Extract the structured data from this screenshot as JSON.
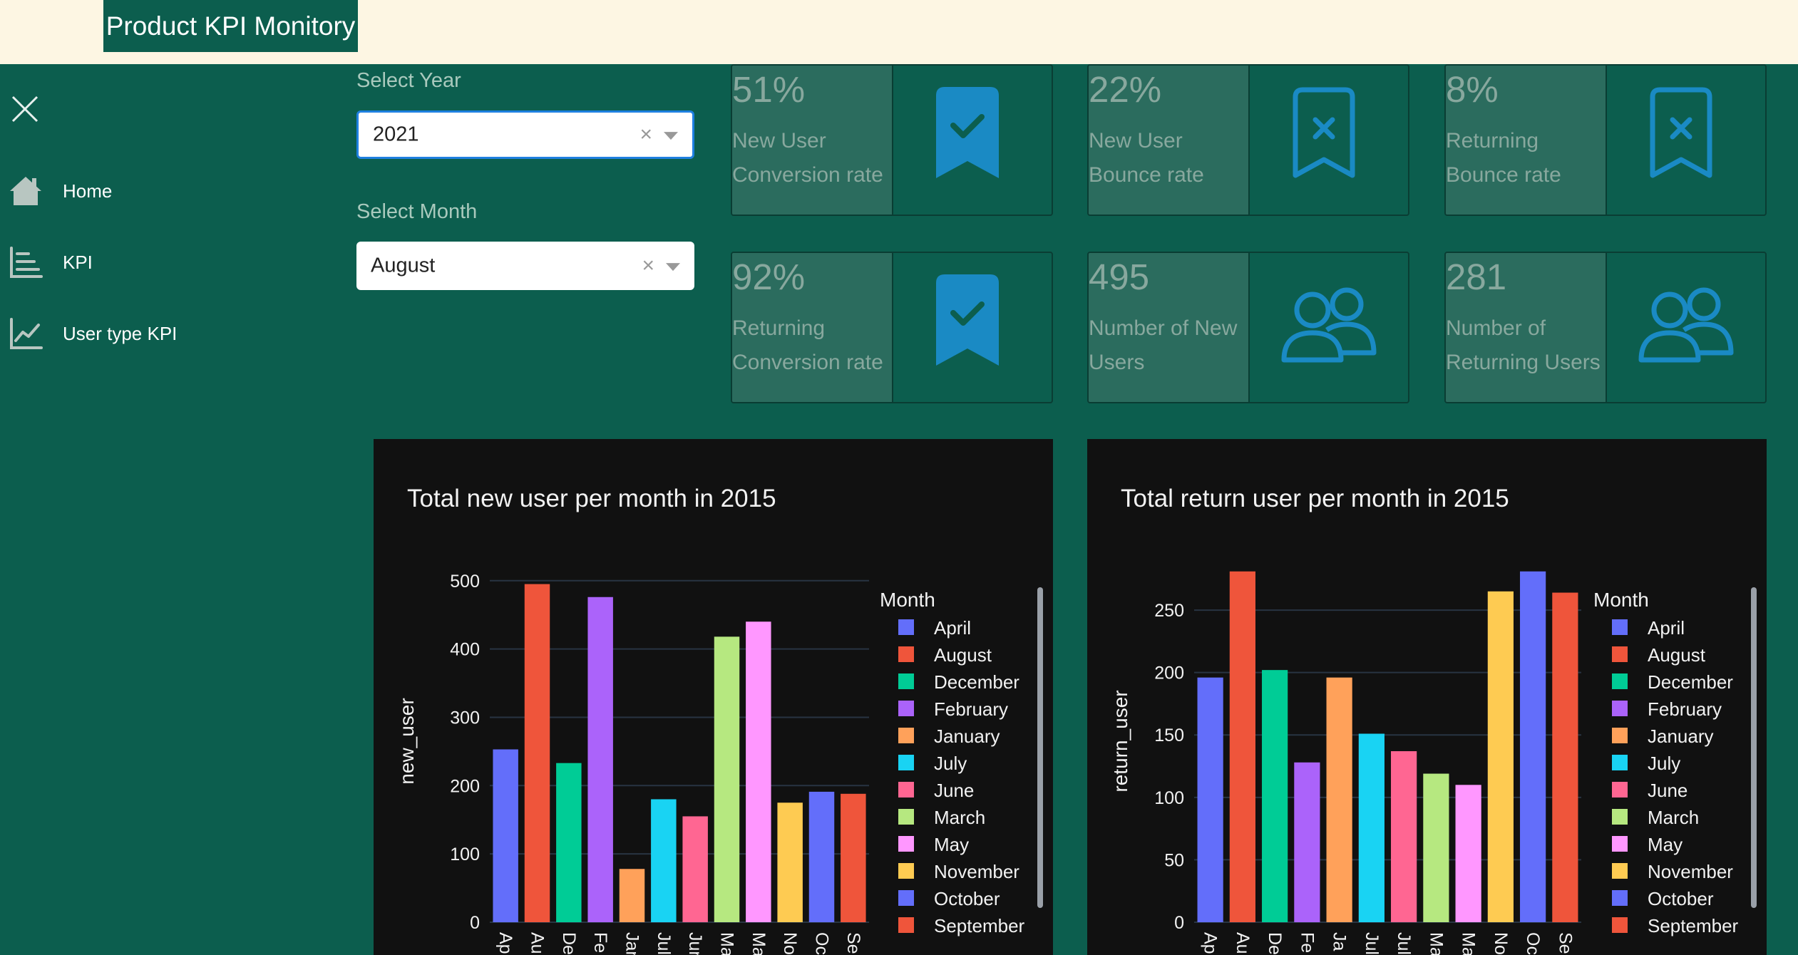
{
  "app": {
    "title": "Product KPI Monitory"
  },
  "sidebar": {
    "items": [
      {
        "label": "Home",
        "icon": "home-icon"
      },
      {
        "label": "KPI",
        "icon": "bar-chart-icon"
      },
      {
        "label": "User type KPI",
        "icon": "line-chart-icon"
      }
    ]
  },
  "filters": {
    "year": {
      "label": "Select Year",
      "value": "2021",
      "clear": "×"
    },
    "month": {
      "label": "Select Month",
      "value": "August",
      "clear": "×"
    }
  },
  "kpis": [
    {
      "value": "51%",
      "label": "New User Conversion rate",
      "icon": "bookmark-check-icon",
      "color": "#1a8ac4"
    },
    {
      "value": "22%",
      "label": "New User Bounce rate",
      "icon": "bookmark-x-icon",
      "color": "#1a8ac4"
    },
    {
      "value": "8%",
      "label": "Returning Bounce rate",
      "icon": "bookmark-x-icon",
      "color": "#1a8ac4"
    },
    {
      "value": "92%",
      "label": "Returning Conversion rate",
      "icon": "bookmark-check-icon",
      "color": "#1a8ac4"
    },
    {
      "value": "495",
      "label": "Number of New Users",
      "icon": "users-icon",
      "color": "#1a8ac4"
    },
    {
      "value": "281",
      "label": "Number of Returning Users",
      "icon": "users-icon",
      "color": "#1a8ac4"
    }
  ],
  "colors": {
    "background": "#0c5e4e",
    "topbar": "#fdf6e3",
    "accent_icon": "#1a8ac4",
    "chart_bg": "#111111"
  },
  "chart_data": [
    {
      "type": "bar",
      "title": "Total new user per month in 2015",
      "ylabel": "new_user",
      "xlabel": "",
      "ylim": [
        0,
        530
      ],
      "yticks": [
        0,
        100,
        200,
        300,
        400,
        500
      ],
      "categories": [
        "April",
        "August",
        "December",
        "February",
        "January",
        "July",
        "June",
        "March",
        "May",
        "November",
        "October",
        "September"
      ],
      "tick_labels": [
        "Ap",
        "Au",
        "De",
        "Fe",
        "Jan",
        "Jul",
        "Jun",
        "Ma",
        "Ma",
        "No",
        "Oc",
        "Se"
      ],
      "values": [
        253,
        495,
        233,
        476,
        78,
        180,
        155,
        418,
        440,
        175,
        191,
        188
      ],
      "legend_title": "Month",
      "legend": [
        "April",
        "August",
        "December",
        "February",
        "January",
        "July",
        "June",
        "March",
        "May",
        "November",
        "October",
        "September"
      ],
      "legend_colors": [
        "#636efa",
        "#ef553b",
        "#00cc96",
        "#ab63fa",
        "#ffa15a",
        "#19d3f3",
        "#ff6692",
        "#b6e880",
        "#ff97ff",
        "#fecb52",
        "#636efa",
        "#ef553b"
      ],
      "grid": true,
      "legend_position": "right"
    },
    {
      "type": "bar",
      "title": "Total return user per month in 2015",
      "ylabel": "return_user",
      "xlabel": "",
      "ylim": [
        0,
        290
      ],
      "yticks": [
        0,
        50,
        100,
        150,
        200,
        250
      ],
      "categories": [
        "April",
        "August",
        "December",
        "February",
        "January",
        "July",
        "June",
        "March",
        "May",
        "November",
        "October",
        "September"
      ],
      "tick_labels": [
        "Ap",
        "Au",
        "De",
        "Fe",
        "Ja",
        "Jul",
        "Jul",
        "Ma",
        "Ma",
        "No",
        "Oc",
        "Se"
      ],
      "values": [
        196,
        281,
        202,
        128,
        196,
        151,
        137,
        119,
        110,
        265,
        281,
        264
      ],
      "legend_title": "Month",
      "legend": [
        "April",
        "August",
        "December",
        "February",
        "January",
        "July",
        "June",
        "March",
        "May",
        "November",
        "October",
        "September"
      ],
      "legend_colors": [
        "#636efa",
        "#ef553b",
        "#00cc96",
        "#ab63fa",
        "#ffa15a",
        "#19d3f3",
        "#ff6692",
        "#b6e880",
        "#ff97ff",
        "#fecb52",
        "#636efa",
        "#ef553b"
      ],
      "grid": true,
      "legend_position": "right"
    }
  ]
}
